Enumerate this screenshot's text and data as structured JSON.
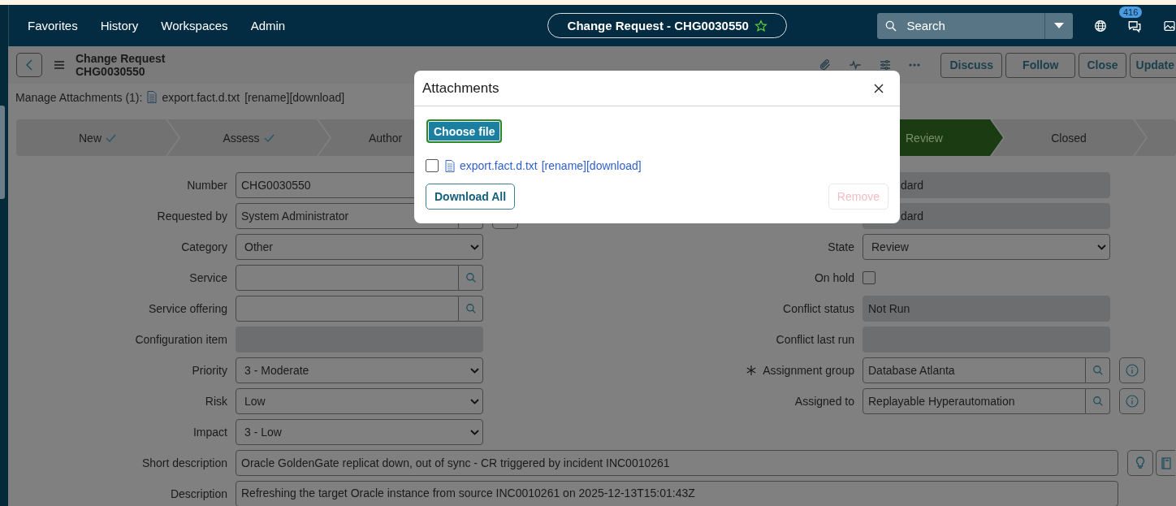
{
  "top_nav": {
    "menus": [
      "Favorites",
      "History",
      "Workspaces",
      "Admin"
    ],
    "record_pill": {
      "title": "Change Request - CHG0030550",
      "favorite": false
    },
    "search": {
      "placeholder": "Search"
    },
    "notifications_badge": "416"
  },
  "header": {
    "title": "Change Request",
    "number": "CHG0030550",
    "actions": [
      "Discuss",
      "Follow",
      "Close",
      "Update"
    ]
  },
  "attachments_line": {
    "label": "Manage Attachments (1):",
    "file": "export.fact.d.txt",
    "links": [
      "[rename]",
      "[download]"
    ]
  },
  "stages": [
    {
      "label": "New",
      "completed": true,
      "selected": false
    },
    {
      "label": "Assess",
      "completed": true,
      "selected": false
    },
    {
      "label": "Author",
      "completed": false,
      "selected": false
    },
    {
      "label": "Review",
      "completed": false,
      "selected": true
    },
    {
      "label": "Closed",
      "completed": false,
      "selected": false
    }
  ],
  "form": {
    "left": [
      {
        "label": "Number",
        "kind": "text",
        "value": "CHG0030550"
      },
      {
        "label": "Requested by",
        "kind": "lookup_covered",
        "value": "System Administrator"
      },
      {
        "label": "Category",
        "kind": "select",
        "value": "Other"
      },
      {
        "label": "Service",
        "kind": "lookup"
      },
      {
        "label": "Service offering",
        "kind": "lookup"
      },
      {
        "label": "Configuration item",
        "kind": "readonly"
      },
      {
        "label": "Priority",
        "kind": "select",
        "value": "3 - Moderate"
      },
      {
        "label": "Risk",
        "kind": "select",
        "value": "Low"
      },
      {
        "label": "Impact",
        "kind": "select",
        "value": "3 - Low"
      }
    ],
    "right": [
      {
        "kind": "readonly_covered",
        "value": "dard",
        "mandatory": false
      },
      {
        "kind": "readonly_covered",
        "value": "dard",
        "mandatory": false
      },
      {
        "label": "State",
        "kind": "select",
        "value": "Review",
        "mandatory": false
      },
      {
        "label": "On hold",
        "kind": "checkbox",
        "checked": false,
        "mandatory": false
      },
      {
        "label": "Conflict status",
        "kind": "readonly",
        "value": "Not Run",
        "mandatory": false
      },
      {
        "label": "Conflict last run",
        "kind": "readonly",
        "mandatory": false
      },
      {
        "label": "Assignment group",
        "kind": "lookup_info",
        "value": "Database Atlanta",
        "mandatory": true
      },
      {
        "label": "Assigned to",
        "kind": "lookup_info",
        "value": "Replayable Hyperautomation",
        "mandatory": false
      }
    ],
    "wide": [
      {
        "label": "Short description",
        "kind": "text_tools",
        "value": "Oracle GoldenGate replicat down, out of sync - CR triggered by incident INC0010261"
      },
      {
        "label": "Description",
        "kind": "textarea",
        "value": "Refreshing the target Oracle instance from source INC0010261 on 2025-12-13T15:01:43Z"
      }
    ]
  },
  "modal": {
    "title": "Attachments",
    "choose_button": "Choose file",
    "files": [
      {
        "name": "export.fact.d.txt",
        "links": [
          "[rename]",
          "[download]"
        ],
        "checked": false
      }
    ],
    "download_all": "Download All",
    "remove": {
      "label": "Remove",
      "disabled": true
    }
  }
}
